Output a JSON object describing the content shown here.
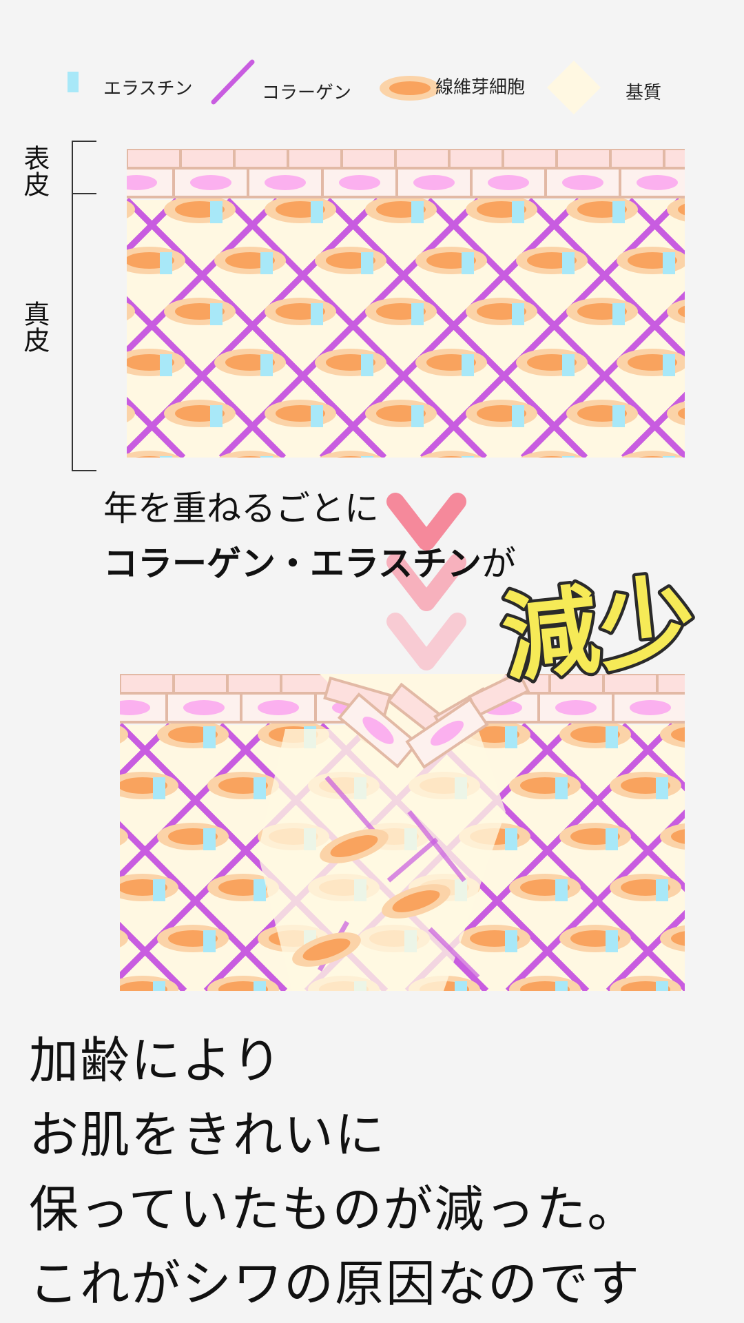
{
  "legend": {
    "elastin": "エラスチン",
    "collagen": "コラーゲン",
    "fibroblast": "線維芽細胞",
    "matrix": "基質"
  },
  "layers": {
    "epidermis": "表皮",
    "dermis": "真皮"
  },
  "caption": {
    "line1": "年を重ねるごとに",
    "line2_bold": "コラーゲン・エラスチン",
    "line2_suffix": "が",
    "decrease": "減少"
  },
  "conclusion": {
    "lines": [
      "加齢により",
      "お肌をきれいに",
      "保っていたものが減った。",
      "これがシワの原因なのです"
    ]
  },
  "colors": {
    "background": "#f4f4f4",
    "elastin": "#a8e8f8",
    "collagen": "#c85ce0",
    "fibroblast_outer": "#fbd3a8",
    "fibroblast_inner": "#f9a35e",
    "matrix": "#fff8e2",
    "epidermis_top": "#fde0de",
    "epidermis_border": "#e2b9a5",
    "epidermis_cell": "#fbb0ef",
    "arrow": "#f5899b",
    "decrease_fill": "#f6ea57",
    "decrease_stroke": "#2a2a2a"
  },
  "icons": {
    "elastin": "elastin-swatch",
    "collagen": "collagen-line",
    "fibroblast": "fibroblast-ellipse",
    "matrix": "matrix-diamond",
    "arrow": "chevron-down-icon"
  }
}
